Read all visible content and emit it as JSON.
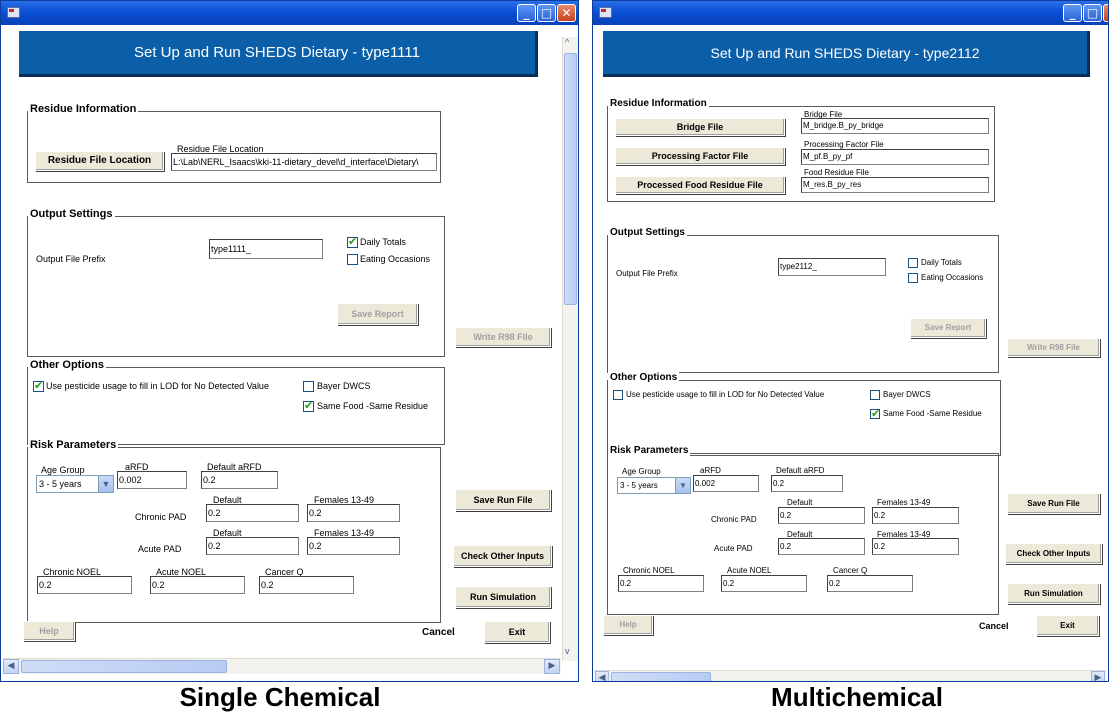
{
  "window_left": {
    "banner_title": "Set Up and Run SHEDS Dietary - type1111",
    "residue_group_title": "Residue Information",
    "residue_file_button": "Residue File Location",
    "residue_file_label": "Residue File Location",
    "residue_file_value": "L:\\Lab\\NERL_Isaacs\\kki-11-dietary_devel\\d_interface\\Dietary\\",
    "output_group_title": "Output Settings",
    "output_prefix_label": "Output File Prefix",
    "output_prefix_value": "type1111_",
    "daily_totals_label": "Daily Totals",
    "daily_totals_checked": true,
    "eating_occasions_label": "Eating Occasions",
    "eating_occasions_checked": false,
    "save_report_button": "Save Report",
    "write_r98_button": "Write R98 File",
    "other_group_title": "Other Options",
    "pesticide_label": "Use pesticide usage to fill in LOD for No Detected Value",
    "pesticide_checked": true,
    "bayer_label": "Bayer DWCS",
    "bayer_checked": false,
    "same_food_label": "Same Food -Same Residue",
    "same_food_checked": true,
    "risk_group_title": "Risk Parameters",
    "age_group_label": "Age Group",
    "age_group_value": "3 - 5 years",
    "arfd_label": "aRFD",
    "arfd_value": "0.002",
    "default_arfd_label": "Default aRFD",
    "default_arfd_value": "0.2",
    "chronic_pad_label": "Chronic PAD",
    "default_label": "Default",
    "females_label": "Females 13-49",
    "chronic_default_value": "0.2",
    "chronic_females_value": "0.2",
    "acute_pad_label": "Acute PAD",
    "acute_default_value": "0.2",
    "acute_females_value": "0.2",
    "chronic_noel_label": "Chronic NOEL",
    "chronic_noel_value": "0.2",
    "acute_noel_label": "Acute NOEL",
    "acute_noel_value": "0.2",
    "cancer_q_label": "Cancer Q",
    "cancer_q_value": "0.2",
    "save_run_button": "Save Run File",
    "check_inputs_button": "Check Other Inputs",
    "run_sim_button": "Run Simulation",
    "help_button": "Help",
    "cancel_button": "Cancel",
    "exit_button": "Exit"
  },
  "window_right": {
    "banner_title": "Set Up and Run SHEDS Dietary - type2112",
    "residue_group_title": "Residue Information",
    "bridge_button": "Bridge File",
    "bridge_label": "Bridge File",
    "bridge_value": "M_bridge.B_py_bridge",
    "processing_button": "Processing Factor File",
    "processing_label": "Processing Factor File",
    "processing_value": "M_pf.B_py_pf",
    "food_residue_button": "Processed Food Residue File",
    "food_residue_label": "Food Residue File",
    "food_residue_value": "M_res.B_py_res",
    "output_group_title": "Output Settings",
    "output_prefix_label": "Output File Prefix",
    "output_prefix_value": "type2112_",
    "daily_totals_label": "Daily Totals",
    "daily_totals_checked": false,
    "eating_occasions_label": "Eating Occasions",
    "eating_occasions_checked": false,
    "save_report_button": "Save Report",
    "write_r98_button": "Write R98 File",
    "other_group_title": "Other Options",
    "pesticide_label": "Use pesticide usage to fill in LOD for No Detected Value",
    "pesticide_checked": false,
    "bayer_label": "Bayer DWCS",
    "bayer_checked": false,
    "same_food_label": "Same Food -Same Residue",
    "same_food_checked": true,
    "risk_group_title": "Risk Parameters",
    "age_group_label": "Age Group",
    "age_group_value": "3 - 5 years",
    "arfd_label": "aRFD",
    "arfd_value": "0.002",
    "default_arfd_label": "Default aRFD",
    "default_arfd_value": "0.2",
    "chronic_pad_label": "Chronic PAD",
    "default_label": "Default",
    "females_label": "Females 13-49",
    "chronic_default_value": "0.2",
    "chronic_females_value": "0.2",
    "acute_pad_label": "Acute PAD",
    "acute_default_value": "0.2",
    "acute_females_value": "0.2",
    "chronic_noel_label": "Chronic NOEL",
    "chronic_noel_value": "0.2",
    "acute_noel_label": "Acute NOEL",
    "acute_noel_value": "0.2",
    "cancer_q_label": "Cancer Q",
    "cancer_q_value": "0.2",
    "save_run_button": "Save Run File",
    "check_inputs_button": "Check Other Inputs",
    "run_sim_button": "Run Simulation",
    "help_button": "Help",
    "cancel_button": "Cancel",
    "exit_button": "Exit"
  },
  "captions": {
    "left": "Single Chemical",
    "right": "Multichemical"
  },
  "icons": {
    "minimize": "minimize-icon",
    "maximize": "maximize-icon",
    "close": "close-icon",
    "dropdown": "chevron-down-icon"
  }
}
